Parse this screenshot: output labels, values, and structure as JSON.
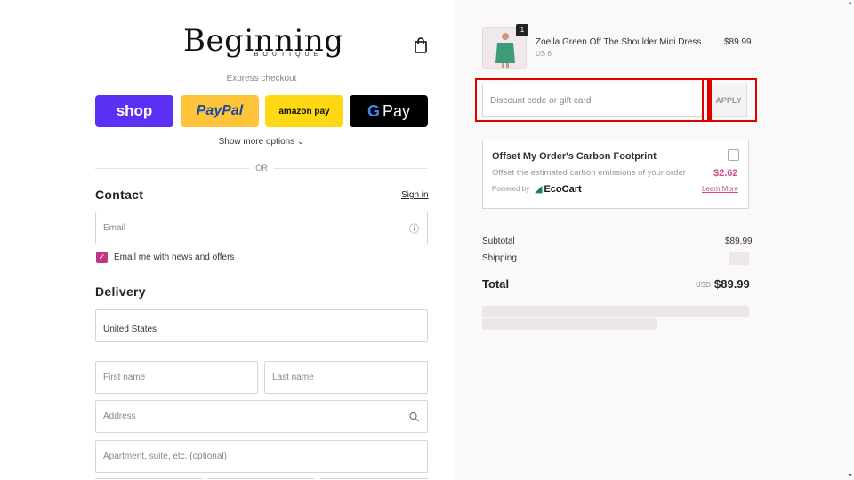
{
  "brand": {
    "name": "Beginning",
    "tagline": "BOUTIQUE"
  },
  "express": {
    "title": "Express checkout",
    "buttons": {
      "shop": "shop",
      "paypal": "PayPal",
      "amazon": "amazon pay",
      "gpay": "Pay"
    },
    "show_more": "Show more options",
    "or": "OR"
  },
  "contact": {
    "title": "Contact",
    "signin": "Sign in",
    "email_placeholder": "Email",
    "newsletter_label": "Email me with news and offers",
    "newsletter_checked": true
  },
  "delivery": {
    "title": "Delivery",
    "country": "United States",
    "first_name_placeholder": "First name",
    "last_name_placeholder": "Last name",
    "address_placeholder": "Address",
    "apartment_placeholder": "Apartment, suite, etc. (optional)"
  },
  "order": {
    "item": {
      "name": "Zoella Green Off The Shoulder Mini Dress",
      "variant": "US 6",
      "price": "$89.99",
      "quantity": "1"
    },
    "discount_placeholder": "Discount code or gift card",
    "apply_label": "APPLY",
    "carbon": {
      "title": "Offset My Order's Carbon Footprint",
      "description": "Offset the estimated carbon emissions of your order",
      "price": "$2.62",
      "powered_by": "Powered by",
      "provider": "EcoCart",
      "learn_more": "Learn More"
    },
    "summary": {
      "subtotal_label": "Subtotal",
      "subtotal_value": "$89.99",
      "shipping_label": "Shipping",
      "total_label": "Total",
      "currency": "USD",
      "total_value": "$89.99"
    }
  },
  "colors": {
    "shop_purple": "#5a31f4",
    "paypal_yellow": "#ffc439",
    "amazon_yellow": "#ffd814",
    "accent_pink": "#d14b8a",
    "highlight_red": "#e00000"
  }
}
